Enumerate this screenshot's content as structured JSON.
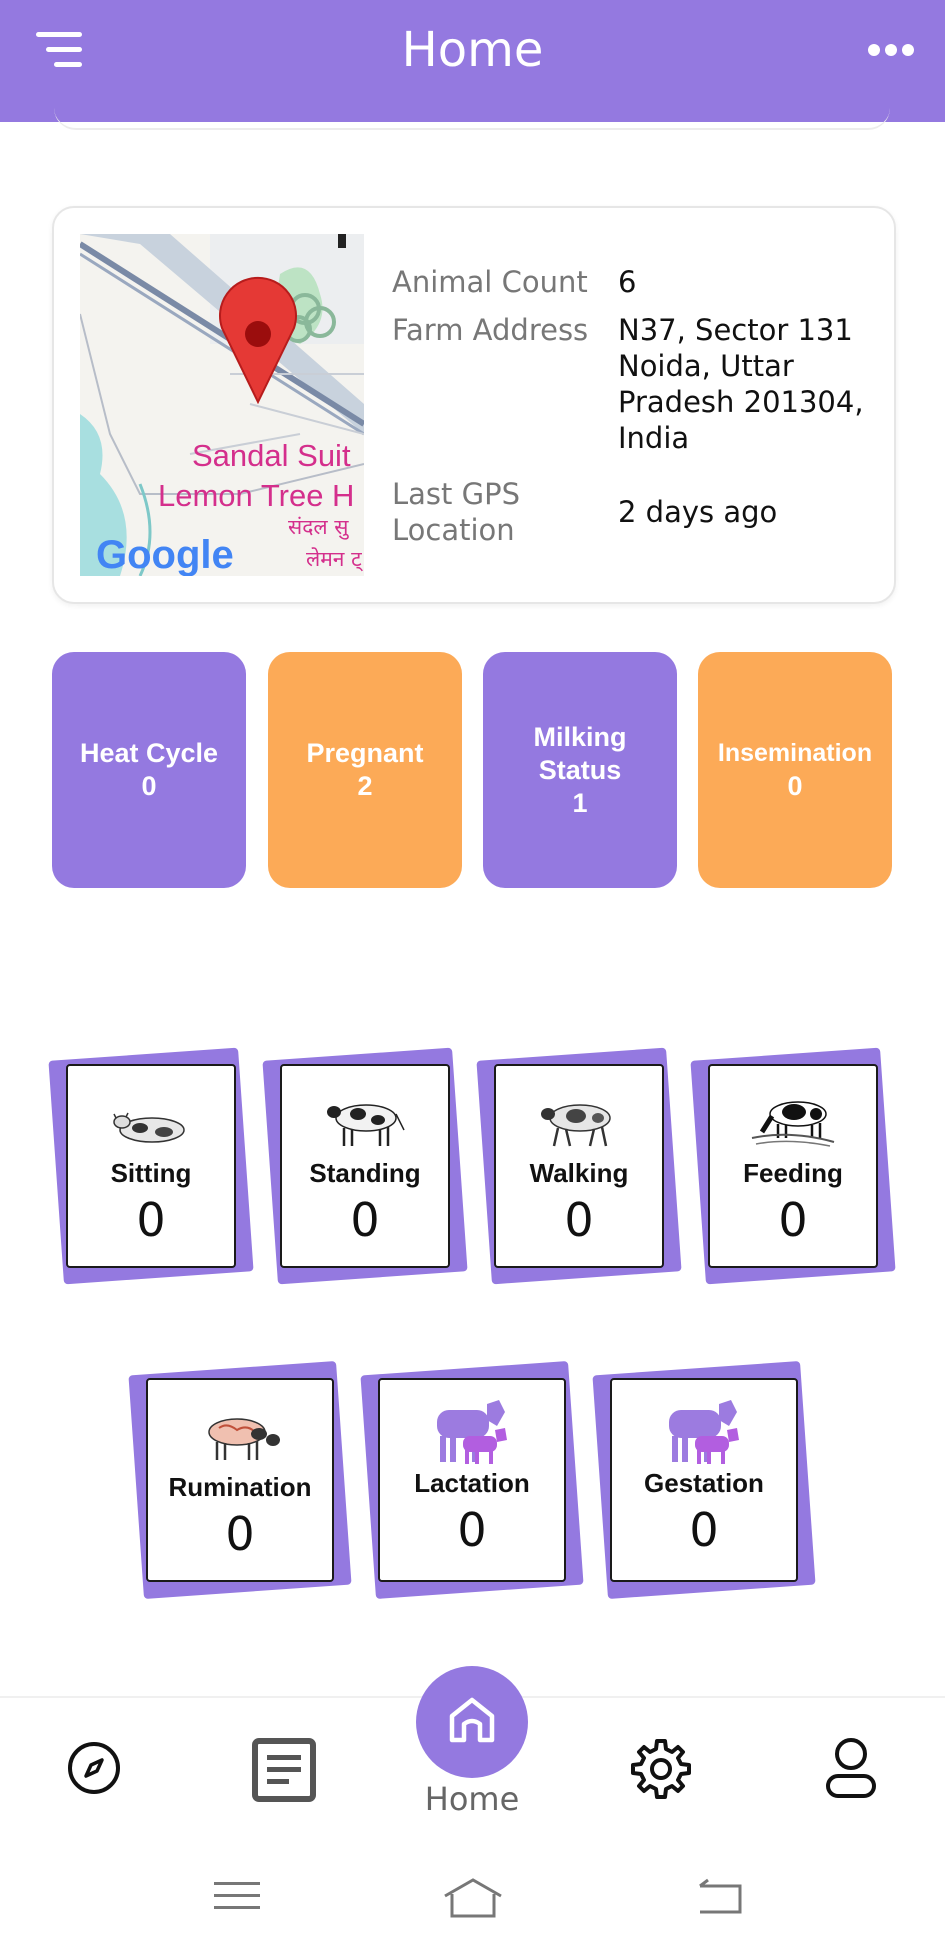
{
  "header": {
    "title": "Home",
    "menu_icon": "hamburger-icon",
    "more_icon": "more-dots-icon"
  },
  "farm": {
    "map_labels": [
      "Sandal Suit",
      "Lemon Tree H",
      "संदल सु",
      "लेमन ट्",
      "Google"
    ],
    "animal_count_label": "Animal Count",
    "animal_count": "6",
    "address_label": "Farm Address",
    "address": "N37, Sector 131 Noida, Uttar Pradesh 201304, India",
    "gps_label": "Last GPS Location",
    "gps_value": "2 days ago"
  },
  "stats": [
    {
      "label": "Heat Cycle",
      "value": "0",
      "color": "#9479e0"
    },
    {
      "label": "Pregnant",
      "value": "2",
      "color": "#fcaa57"
    },
    {
      "label": "Milking Status",
      "value": "1",
      "color": "#9479e0"
    },
    {
      "label": "Insemination",
      "value": "0",
      "color": "#fcaa57"
    }
  ],
  "behaviours": [
    {
      "label": "Sitting",
      "value": "0",
      "icon": "cow-sitting-icon"
    },
    {
      "label": "Standing",
      "value": "0",
      "icon": "cow-standing-icon"
    },
    {
      "label": "Walking",
      "value": "0",
      "icon": "cow-walking-icon"
    },
    {
      "label": "Feeding",
      "value": "0",
      "icon": "cow-feeding-icon"
    },
    {
      "label": "Rumination",
      "value": "0",
      "icon": "cow-rumination-icon"
    },
    {
      "label": "Lactation",
      "value": "0",
      "icon": "cow-calf-icon"
    },
    {
      "label": "Gestation",
      "value": "0",
      "icon": "cow-calf-icon"
    }
  ],
  "bottom_nav": {
    "home_label": "Home",
    "icons": [
      "compass-icon",
      "document-icon",
      "home-icon",
      "gear-icon",
      "user-icon"
    ]
  },
  "colors": {
    "accent": "#9479e0",
    "orange": "#fcaa57"
  }
}
